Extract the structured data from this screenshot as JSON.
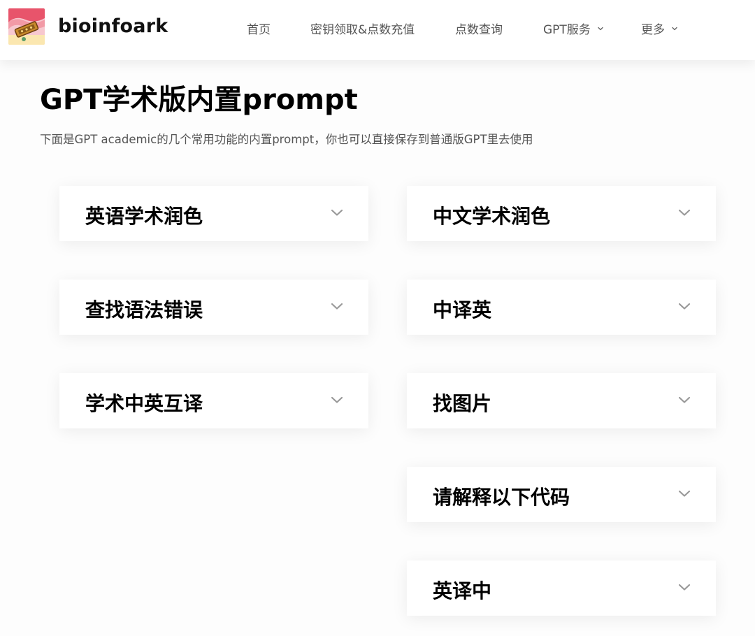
{
  "header": {
    "brand": "bioinfoark",
    "nav": [
      {
        "label": "首页",
        "has_dropdown": false
      },
      {
        "label": "密钥领取&点数充值",
        "has_dropdown": false
      },
      {
        "label": "点数查询",
        "has_dropdown": false
      },
      {
        "label": "GPT服务",
        "has_dropdown": true
      },
      {
        "label": "更多",
        "has_dropdown": true
      }
    ]
  },
  "main": {
    "title": "GPT学术版内置prompt",
    "intro": "下面是GPT academic的几个常用功能的内置prompt，你也可以直接保存到普通版GPT里去使用",
    "left_column": [
      {
        "title": "英语学术润色"
      },
      {
        "title": "查找语法错误"
      },
      {
        "title": "学术中英互译"
      }
    ],
    "right_column": [
      {
        "title": "中文学术润色"
      },
      {
        "title": "中译英"
      },
      {
        "title": "找图片"
      },
      {
        "title": "请解释以下代码"
      },
      {
        "title": "英译中"
      }
    ]
  },
  "icons": {
    "accordion_toggle": "chevron-down-icon",
    "nav_dropdown": "chevron-down-icon"
  },
  "colors": {
    "nav_text": "#555555",
    "title_text": "#000000",
    "chevron": "#999999",
    "card_bg": "#ffffff"
  }
}
